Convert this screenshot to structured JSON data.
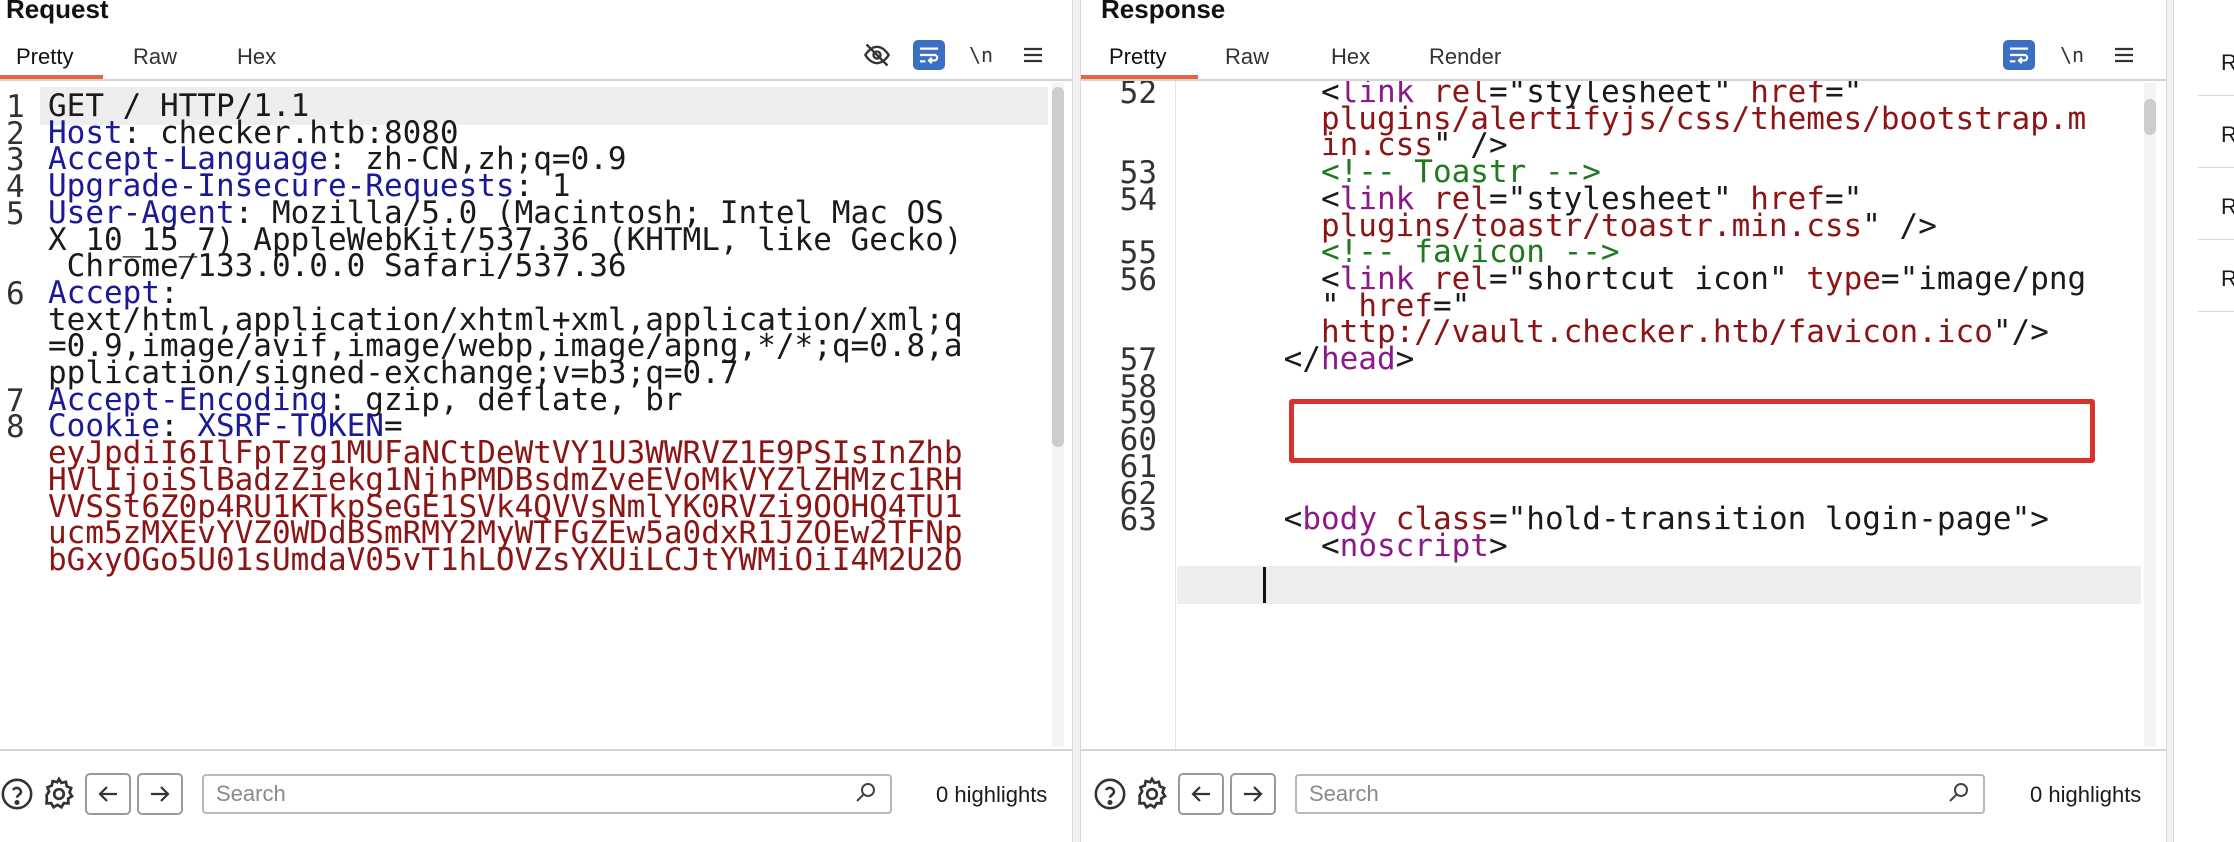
{
  "request": {
    "title": "Request",
    "tabs": [
      "Pretty",
      "Raw",
      "Hex"
    ],
    "newline_label": "\\n",
    "lines": [
      {
        "n": "1",
        "parts": [
          {
            "t": "GET / HTTP/1.1",
            "c": "plain"
          }
        ]
      },
      {
        "n": "2",
        "parts": [
          {
            "t": "Host",
            "c": "blue"
          },
          {
            "t": ": checker.htb:8080",
            "c": "plain"
          }
        ]
      },
      {
        "n": "3",
        "parts": [
          {
            "t": "Accept-Language",
            "c": "blue"
          },
          {
            "t": ": zh-CN,zh;q=0.9",
            "c": "plain"
          }
        ]
      },
      {
        "n": "4",
        "parts": [
          {
            "t": "Upgrade-Insecure-Requests",
            "c": "blue"
          },
          {
            "t": ": 1",
            "c": "plain"
          }
        ]
      },
      {
        "n": "5",
        "parts": [
          {
            "t": "User-Agent",
            "c": "blue"
          },
          {
            "t": ": Mozilla/5.0 (Macintosh; Intel Mac OS",
            "c": "plain"
          }
        ]
      },
      {
        "n": "",
        "parts": [
          {
            "t": "X 10_15_7) AppleWebKit/537.36 (KHTML, like Gecko)",
            "c": "plain"
          }
        ]
      },
      {
        "n": "",
        "parts": [
          {
            "t": " Chrome/133.0.0.0 Safari/537.36",
            "c": "plain"
          }
        ]
      },
      {
        "n": "6",
        "parts": [
          {
            "t": "Accept",
            "c": "blue"
          },
          {
            "t": ":",
            "c": "plain"
          }
        ]
      },
      {
        "n": "",
        "parts": [
          {
            "t": "text/html,application/xhtml+xml,application/xml;q",
            "c": "plain"
          }
        ]
      },
      {
        "n": "",
        "parts": [
          {
            "t": "=0.9,image/avif,image/webp,image/apng,*/*;q=0.8,a",
            "c": "plain"
          }
        ]
      },
      {
        "n": "",
        "parts": [
          {
            "t": "pplication/signed-exchange;v=b3;q=0.7",
            "c": "plain"
          }
        ]
      },
      {
        "n": "7",
        "parts": [
          {
            "t": "Accept-Encoding",
            "c": "blue"
          },
          {
            "t": ": gzip, deflate, br",
            "c": "plain"
          }
        ]
      },
      {
        "n": "8",
        "parts": [
          {
            "t": "Cookie",
            "c": "blue"
          },
          {
            "t": ": ",
            "c": "plain"
          },
          {
            "t": "XSRF-TOKEN",
            "c": "blue"
          },
          {
            "t": "=",
            "c": "plain"
          }
        ]
      },
      {
        "n": "",
        "parts": [
          {
            "t": "eyJpdiI6IlFpTzg1MUFaNCtDeWtVY1U3WWRVZ1E9PSIsInZhb",
            "c": "red"
          }
        ]
      },
      {
        "n": "",
        "parts": [
          {
            "t": "HVlIjoiSlBadzZiekg1NjhPMDBsdmZveEVoMkVYZlZHMzc1RH",
            "c": "red"
          }
        ]
      },
      {
        "n": "",
        "parts": [
          {
            "t": "VVSSt6Z0p4RU1KTkpSeGE1SVk4QVVsNmlYK0RVZi9OOHQ4TU1",
            "c": "red"
          }
        ]
      },
      {
        "n": "",
        "parts": [
          {
            "t": "ucm5zMXEvYVZ0WDdBSmRMY2MyWTFGZEw5a0dxR1JZOEw2TFNp",
            "c": "red"
          }
        ]
      },
      {
        "n": "",
        "parts": [
          {
            "t": "bGxyOGo5U01sUmdaV05vT1hLOVZsYXUiLCJtYWMiOiI4M2U2O",
            "c": "red"
          }
        ]
      }
    ],
    "search_placeholder": "Search",
    "highlights": "0 highlights"
  },
  "response": {
    "title": "Response",
    "tabs": [
      "Pretty",
      "Raw",
      "Hex",
      "Render"
    ],
    "newline_label": "\\n",
    "lines": [
      {
        "n": "52",
        "parts": [
          {
            "t": "      <",
            "c": "plain"
          },
          {
            "t": "link",
            "c": "purple"
          },
          {
            "t": " ",
            "c": "plain"
          },
          {
            "t": "rel",
            "c": "red"
          },
          {
            "t": "=\"stylesheet\" ",
            "c": "plain"
          },
          {
            "t": "href",
            "c": "red"
          },
          {
            "t": "=\"",
            "c": "plain"
          }
        ]
      },
      {
        "n": "",
        "parts": [
          {
            "t": "      plugins/alertifyjs/css/themes/bootstrap.m",
            "c": "red"
          }
        ]
      },
      {
        "n": "",
        "parts": [
          {
            "t": "      in.css",
            "c": "red"
          },
          {
            "t": "\" />",
            "c": "plain"
          }
        ]
      },
      {
        "n": "53",
        "parts": [
          {
            "t": "      <!-- Toastr -->",
            "c": "green"
          }
        ]
      },
      {
        "n": "54",
        "parts": [
          {
            "t": "      <",
            "c": "plain"
          },
          {
            "t": "link",
            "c": "purple"
          },
          {
            "t": " ",
            "c": "plain"
          },
          {
            "t": "rel",
            "c": "red"
          },
          {
            "t": "=\"stylesheet\" ",
            "c": "plain"
          },
          {
            "t": "href",
            "c": "red"
          },
          {
            "t": "=\"",
            "c": "plain"
          }
        ]
      },
      {
        "n": "",
        "parts": [
          {
            "t": "      plugins/toastr/toastr.min.css",
            "c": "red"
          },
          {
            "t": "\" />",
            "c": "plain"
          }
        ]
      },
      {
        "n": "55",
        "parts": [
          {
            "t": "      <!-- favicon -->",
            "c": "green"
          }
        ]
      },
      {
        "n": "56",
        "parts": [
          {
            "t": "      <",
            "c": "plain"
          },
          {
            "t": "link",
            "c": "purple"
          },
          {
            "t": " ",
            "c": "plain"
          },
          {
            "t": "rel",
            "c": "red"
          },
          {
            "t": "=\"shortcut icon\" ",
            "c": "plain"
          },
          {
            "t": "type",
            "c": "red"
          },
          {
            "t": "=\"image/png",
            "c": "plain"
          }
        ]
      },
      {
        "n": "",
        "parts": [
          {
            "t": "      \" ",
            "c": "plain"
          },
          {
            "t": "href",
            "c": "red"
          },
          {
            "t": "=\"",
            "c": "plain"
          }
        ]
      },
      {
        "n": "",
        "parts": [
          {
            "t": "      http://vault.checker.htb/favicon.ico",
            "c": "red"
          },
          {
            "t": "\"/>",
            "c": "plain"
          }
        ]
      },
      {
        "n": "57",
        "parts": [
          {
            "t": "    </",
            "c": "plain"
          },
          {
            "t": "head",
            "c": "purple"
          },
          {
            "t": ">",
            "c": "plain"
          }
        ]
      },
      {
        "n": "58",
        "parts": []
      },
      {
        "n": "59",
        "parts": []
      },
      {
        "n": "60",
        "parts": []
      },
      {
        "n": "61",
        "parts": []
      },
      {
        "n": "62",
        "parts": []
      },
      {
        "n": "63",
        "parts": [
          {
            "t": "    <",
            "c": "plain"
          },
          {
            "t": "body",
            "c": "purple"
          },
          {
            "t": " ",
            "c": "plain"
          },
          {
            "t": "class",
            "c": "red"
          },
          {
            "t": "=\"hold-transition login-page\">",
            "c": "plain"
          }
        ]
      },
      {
        "n": "",
        "parts": [
          {
            "t": "      <",
            "c": "plain"
          },
          {
            "t": "noscript",
            "c": "purple"
          },
          {
            "t": ">",
            "c": "plain"
          }
        ]
      }
    ],
    "search_placeholder": "Search",
    "highlights": "0 highlights"
  },
  "sidebar": {
    "items": [
      "Req",
      "Req",
      "Req",
      "Res"
    ]
  },
  "colors": {
    "accent": "#e8643c",
    "wrap_button": "#3b6fc4",
    "annotation": "#d9322c",
    "key_blue": "#1a1a99",
    "value_red": "#8b1414",
    "comment_green": "#1f7a1f",
    "tag_purple": "#8a1a8a"
  },
  "icons": {
    "eye_off": "eye-off-icon",
    "wrap": "wrap-icon",
    "menu": "menu-icon",
    "help": "help-icon",
    "settings": "gear-icon",
    "back": "arrow-left-icon",
    "forward": "arrow-right-icon",
    "search": "search-icon"
  }
}
